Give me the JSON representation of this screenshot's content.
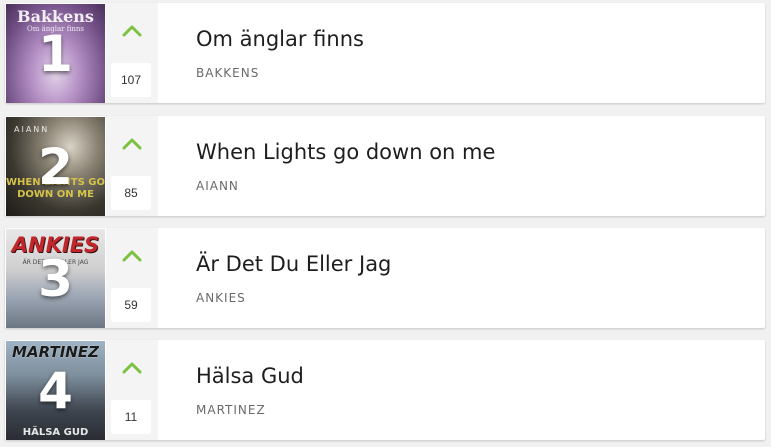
{
  "accent_color": "#7cc242",
  "items": [
    {
      "rank": "1",
      "title": "Om änglar finns",
      "artist": "BAKKENS",
      "votes": "107",
      "cover_text": "Bakkens",
      "cover_subtext": "Om änglar finns"
    },
    {
      "rank": "2",
      "title": "When Lights go down on me",
      "artist": "AIANN",
      "votes": "85",
      "cover_text": "AIANN",
      "cover_subtext": "WHEN LIGHTS GO DOWN ON ME"
    },
    {
      "rank": "3",
      "title": "Är Det Du Eller Jag",
      "artist": "ANKIES",
      "votes": "59",
      "cover_text": "ANKIES",
      "cover_subtext": "ÄR DET DU ELLER JAG"
    },
    {
      "rank": "4",
      "title": "Hälsa Gud",
      "artist": "MARTINEZ",
      "votes": "11",
      "cover_text": "MARTINEZ",
      "cover_subtext": "HÄLSA GUD"
    }
  ]
}
